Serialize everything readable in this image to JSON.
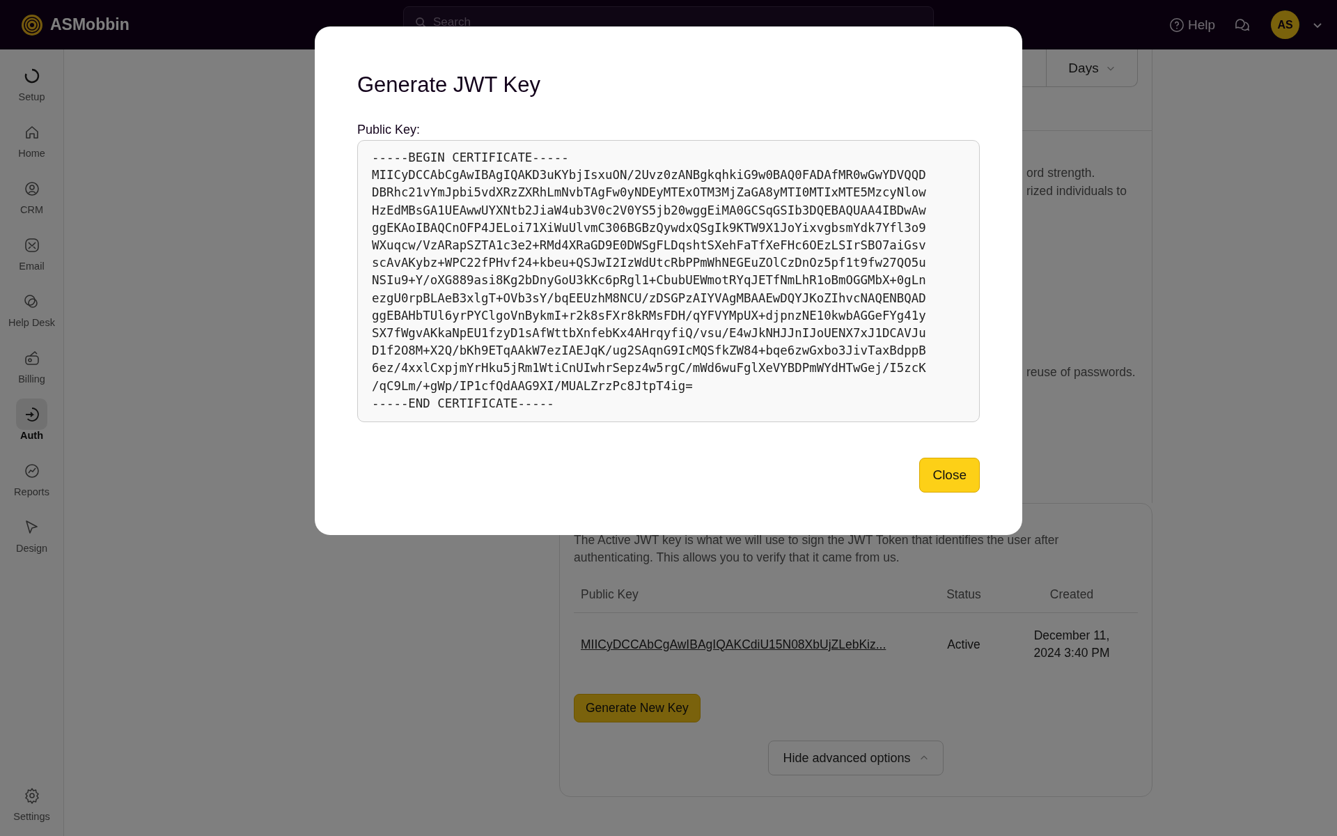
{
  "app": {
    "name": "ASMobbin"
  },
  "search": {
    "placeholder": "Search"
  },
  "header_actions": {
    "help": "Help",
    "avatar": "AS"
  },
  "sidebar": {
    "items": [
      {
        "label": "Setup",
        "selected": false
      },
      {
        "label": "Home",
        "selected": false
      },
      {
        "label": "CRM",
        "selected": false
      },
      {
        "label": "Email",
        "selected": false
      },
      {
        "label": "Help Desk",
        "selected": false
      },
      {
        "label": "Billing",
        "selected": false
      },
      {
        "label": "Auth",
        "selected": true
      },
      {
        "label": "Reports",
        "selected": false
      },
      {
        "label": "Design",
        "selected": false
      }
    ],
    "footer": {
      "label": "Settings"
    }
  },
  "background": {
    "days_select": "Days",
    "text_fragments": [
      "ord strength.",
      "rized individuals to",
      "reuse of passwords."
    ],
    "jwt_card": {
      "description": "The Active JWT key is what we will use to sign the JWT Token that identifies the user after authenticating. This allows you to verify that it came from us.",
      "columns": [
        "Public Key",
        "Status",
        "Created"
      ],
      "rows": [
        {
          "public_key": "MIICyDCCAbCgAwIBAgIQAKCdiU15N08XbUjZLebKiz...",
          "status": "Active",
          "created": "December 11, 2024 3:40 PM"
        }
      ],
      "generate_button": "Generate New Key",
      "toggle_button": "Hide advanced options"
    }
  },
  "modal": {
    "title": "Generate JWT Key",
    "field_label": "Public Key:",
    "public_key": "-----BEGIN CERTIFICATE-----\nMIICyDCCAbCgAwIBAgIQAKD3uKYbjIsxuON/2Uvz0zANBgkqhkiG9w0BAQ0FADAfMR0wGwYDVQQD\nDBRhc21vYmJpbi5vdXRzZXRhLmNvbTAgFw0yNDEyMTExOTM3MjZaGA8yMTI0MTIxMTE5MzcyNlow\nHzEdMBsGA1UEAwwUYXNtb2JiaW4ub3V0c2V0YS5jb20wggEiMA0GCSqGSIb3DQEBAQUAA4IBDwAw\nggEKAoIBAQCnOFP4JELoi71XiWuUlvmC306BGBzQywdxQSgIk9KTW9X1JoYixvgbsmYdk7Yfl3o9\nWXuqcw/VzARapSZTA1c3e2+RMd4XRaGD9E0DWSgFLDqshtSXehFaTfXeFHc6OEzLSIrSBO7aiGsv\nscAvAKybz+WPC22fPHvf24+kbeu+QSJwI2IzWdUtcRbPPmWhNEGEuZOlCzDnOz5pf1t9fw27QO5u\nNSIu9+Y/oXG889asi8Kg2bDnyGoU3kKc6pRgl1+CbubUEWmotRYqJETfNmLhR1oBmOGGMbX+0gLn\nezgU0rpBLAeB3xlgT+OVb3sY/bqEEUzhM8NCU/zDSGPzAIYVAgMBAAEwDQYJKoZIhvcNAQENBQAD\nggEBAHbTUl6yrPYClgoVnBykmI+r2k8sFXr8kRMsFDH/qYFVYMpUX+djpnzNE10kwbAGGeFYg41y\nSX7fWgvAKkaNpEU1fzyD1sAfWttbXnfebKx4AHrqyfiQ/vsu/E4wJkNHJJnIJoUENX7xJ1DCAVJu\nD1f2O8M+X2Q/bKh9ETqAAkW7ezIAEJqK/ug2SAqnG9IcMQSfkZW84+bqe6zwGxbo3JivTaxBdppB\n6ez/4xxlCxpjmYrHku5jRm1WtiCnUIwhrSepz4w5rgC/mWd6wuFglXeVYBDPmWYdHTwGej/I5zcK\n/qC9Lm/+gWp/IP1cfQdAAG9XI/MUALZrzPc8JtpT4ig=\n-----END CERTIFICATE-----",
    "close_button": "Close"
  }
}
